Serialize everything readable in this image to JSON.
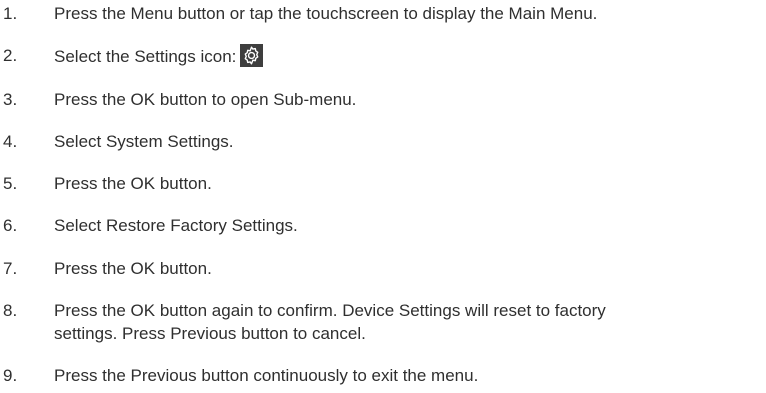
{
  "steps": [
    {
      "number": "1.",
      "text": "Press the Menu button or tap the touchscreen to display the Main Menu."
    },
    {
      "number": "2.",
      "text": "Select the Settings icon:",
      "icon": "gear-icon"
    },
    {
      "number": "3.",
      "text": "Press the OK button to open Sub-menu."
    },
    {
      "number": "4.",
      "text": "Select System Settings."
    },
    {
      "number": "5.",
      "text": "Press the OK button."
    },
    {
      "number": "6.",
      "text": "Select Restore Factory Settings."
    },
    {
      "number": "7.",
      "text": "Press the OK button."
    },
    {
      "number": "8.",
      "text_line1": "Press the OK button again to confirm. Device Settings will reset to factory",
      "text_line2": "settings. Press Previous button to cancel."
    },
    {
      "number": "9.",
      "text": "Press the Previous button continuously to exit the menu."
    }
  ]
}
